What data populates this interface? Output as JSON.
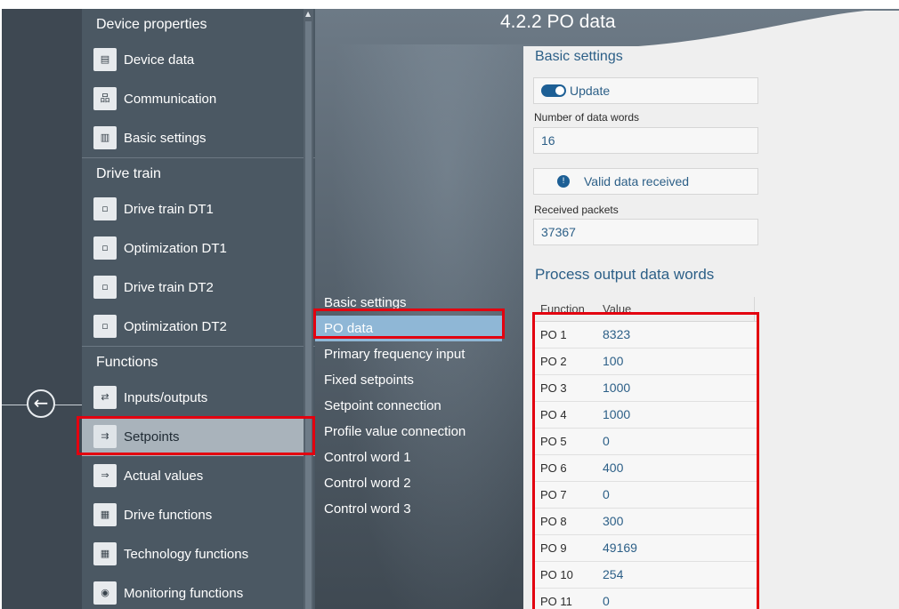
{
  "page_title": "4.2.2 PO data",
  "back_icon": "arrow-left-icon",
  "nav": {
    "sections": [
      {
        "title": "Device properties",
        "items": [
          {
            "label": "Device data",
            "icon": "device-data-icon",
            "glyph": "▤"
          },
          {
            "label": "Communication",
            "icon": "network-icon",
            "glyph": "品"
          },
          {
            "label": "Basic settings",
            "icon": "settings-chart-icon",
            "glyph": "▥"
          }
        ]
      },
      {
        "title": "Drive train",
        "items": [
          {
            "label": "Drive train DT1",
            "icon": "drive-train-icon",
            "glyph": "▫"
          },
          {
            "label": "Optimization DT1",
            "icon": "drive-train-icon",
            "glyph": "▫"
          },
          {
            "label": "Drive train DT2",
            "icon": "drive-train-icon",
            "glyph": "▫"
          },
          {
            "label": "Optimization DT2",
            "icon": "drive-train-icon",
            "glyph": "▫"
          }
        ]
      },
      {
        "title": "Functions",
        "items": [
          {
            "label": "Inputs/outputs",
            "icon": "io-icon",
            "glyph": "⇄"
          },
          {
            "label": "Setpoints",
            "icon": "setpoints-icon",
            "glyph": "⇉"
          },
          {
            "label": "Actual values",
            "icon": "actual-values-icon",
            "glyph": "⇒"
          },
          {
            "label": "Drive functions",
            "icon": "drive-functions-icon",
            "glyph": "▦"
          },
          {
            "label": "Technology functions",
            "icon": "technology-functions-icon",
            "glyph": "▦"
          },
          {
            "label": "Monitoring functions",
            "icon": "monitoring-eye-icon",
            "glyph": "◉"
          }
        ]
      }
    ],
    "selected": "Setpoints"
  },
  "submenu": {
    "items": [
      "Basic settings",
      "PO data",
      "Primary frequency input",
      "Fixed setpoints",
      "Setpoint connection",
      "Profile value connection",
      "Control word 1",
      "Control word 2",
      "Control word 3"
    ],
    "active": "PO data"
  },
  "basic_settings": {
    "title": "Basic settings",
    "update_label": "Update",
    "data_words_label": "Number of data words",
    "data_words_value": "16",
    "status_text": "Valid data received",
    "status_icon": "info-icon",
    "received_label": "Received packets",
    "received_value": "37367"
  },
  "po_table": {
    "title": "Process output data words",
    "headers": [
      "Function",
      "Value"
    ],
    "rows": [
      [
        "PO 1",
        "8323"
      ],
      [
        "PO 2",
        "100"
      ],
      [
        "PO 3",
        "1000"
      ],
      [
        "PO 4",
        "1000"
      ],
      [
        "PO 5",
        "0"
      ],
      [
        "PO 6",
        "400"
      ],
      [
        "PO 7",
        "0"
      ],
      [
        "PO 8",
        "300"
      ],
      [
        "PO 9",
        "49169"
      ],
      [
        "PO 10",
        "254"
      ],
      [
        "PO 11",
        "0"
      ]
    ]
  },
  "colors": {
    "accent": "#1d5f95",
    "highlight": "#e3000f",
    "selected_sub": "#8fb7d6"
  }
}
